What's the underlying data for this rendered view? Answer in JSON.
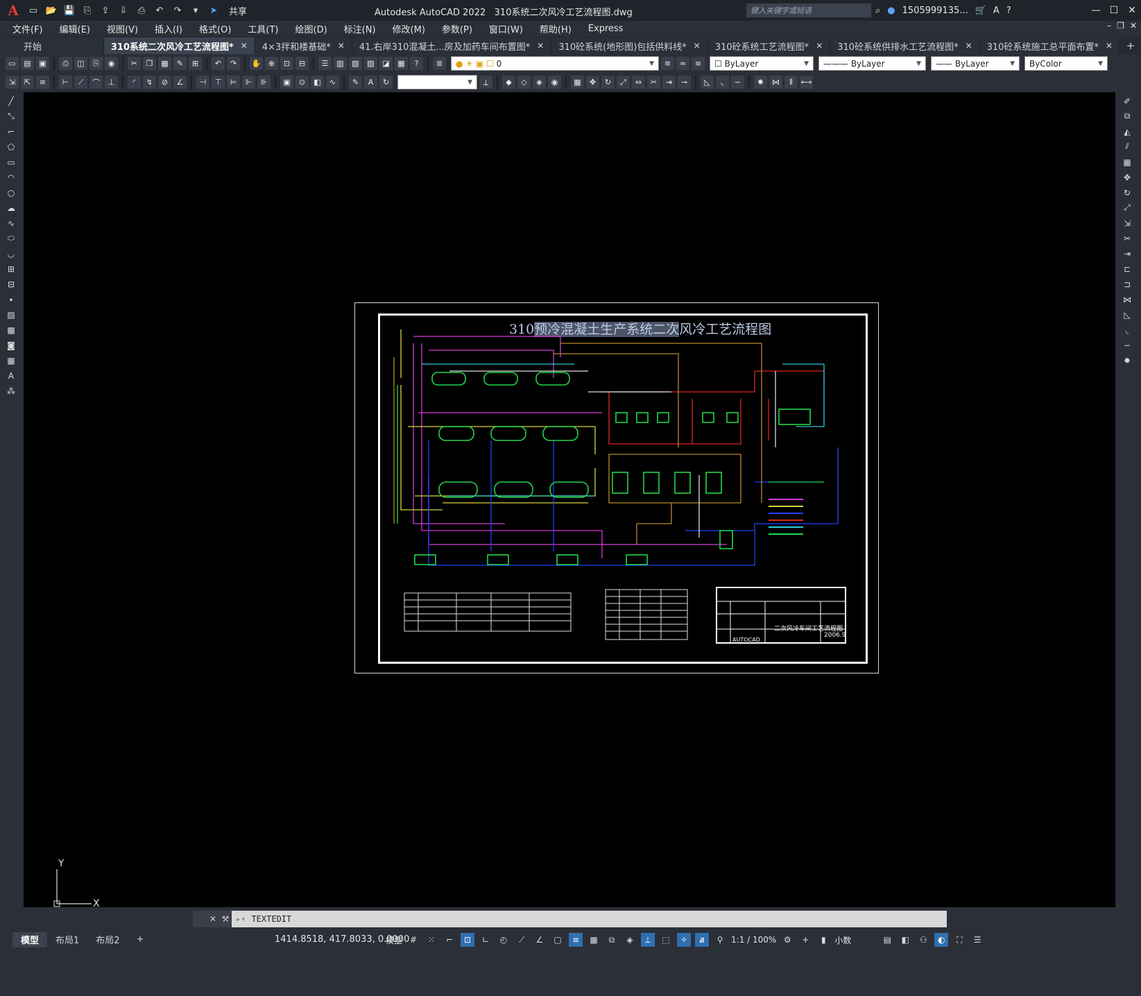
{
  "app": {
    "title": "Autodesk AutoCAD 2022",
    "file": "310系统二次风冷工艺流程图.dwg",
    "share": "共享"
  },
  "search": {
    "placeholder": "键入关键字或短语"
  },
  "user": {
    "name": "1505999135..."
  },
  "menu": [
    "文件(F)",
    "编辑(E)",
    "视图(V)",
    "插入(I)",
    "格式(O)",
    "工具(T)",
    "绘图(D)",
    "标注(N)",
    "修改(M)",
    "参数(P)",
    "窗口(W)",
    "帮助(H)",
    "Express"
  ],
  "tabs": [
    {
      "label": "开始",
      "active": false
    },
    {
      "label": "310系统二次风冷工艺流程图*",
      "active": true
    },
    {
      "label": "4×3拌和楼基础*",
      "active": false
    },
    {
      "label": "41.右岸310混凝土...房及加药车间布置图*",
      "active": false
    },
    {
      "label": "310砼系统(地形图)包括供料线*",
      "active": false
    },
    {
      "label": "310砼系统工艺流程图*",
      "active": false
    },
    {
      "label": "310砼系统供排水工艺流程图*",
      "active": false
    },
    {
      "label": "310砼系统施工总平面布置*",
      "active": false
    }
  ],
  "properties": {
    "layer": "0",
    "color": "ByLayer",
    "linetype": "ByLayer",
    "lineweight": "ByLayer",
    "plotstyle": "ByColor"
  },
  "drawing": {
    "title_prefix": "310",
    "title_hl": "预冷混凝土生产系统二次",
    "title_rest": "风冷工艺流程图",
    "titleblock_name": "二次风冷车间工艺流程图",
    "titleblock_date": "2006.9",
    "titleblock_software": "AUTOCAD"
  },
  "colors": {
    "canvas": "#000000",
    "accent": "#2f6fb0",
    "pipe_magenta": "#d53cd8",
    "pipe_yellow": "#d9d23a",
    "pipe_green": "#22d64a",
    "pipe_blue": "#2240ff",
    "pipe_red": "#e02424",
    "pipe_brown": "#b88a2a"
  },
  "ucs": {
    "x": "X",
    "y": "Y"
  },
  "command": {
    "text": "TEXTEDIT"
  },
  "layouts": [
    "模型",
    "布局1",
    "布局2"
  ],
  "status": {
    "coords": "1414.8518, 417.8033, 0.0000",
    "space": "模型",
    "scale": "1:1 / 100%",
    "units": "小数"
  }
}
